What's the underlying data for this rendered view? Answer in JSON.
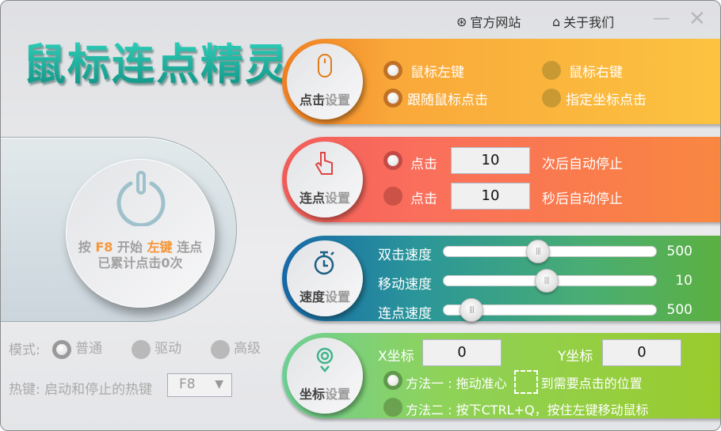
{
  "titlebar": {
    "official_site": "官方网站",
    "about_us": "关于我们",
    "minimize": "—",
    "close": "✕"
  },
  "logo": "鼠标连点精灵",
  "start": {
    "line1_pre": "按",
    "hotkey": "F8",
    "line1_mid": "开始",
    "button": "左键",
    "line1_post": "连点",
    "line2": "已累计点击0次"
  },
  "mode": {
    "label": "模式:",
    "options": [
      "普通",
      "驱动",
      "高级"
    ],
    "selected": 0
  },
  "hotkey": {
    "label": "热键: 启动和停止的热键",
    "value": "F8",
    "arrow": "▼"
  },
  "click_settings": {
    "title_a": "点击",
    "title_b": "设置",
    "options": [
      "鼠标左键",
      "鼠标右键",
      "跟随鼠标点击",
      "指定坐标点击"
    ],
    "colors": [
      "#f08a28",
      "#fcc23c"
    ]
  },
  "repeat_settings": {
    "title_a": "连点",
    "title_b": "设置",
    "row1": {
      "label": "点击",
      "value": "10",
      "suffix": "次后自动停止",
      "selected": true
    },
    "row2": {
      "label": "点击",
      "value": "10",
      "suffix": "秒后自动停止",
      "selected": false
    },
    "colors": [
      "#f5675c",
      "#f98540"
    ]
  },
  "speed_settings": {
    "title_a": "速度",
    "title_b": "设置",
    "sliders": [
      {
        "label": "双击速度",
        "value": "500",
        "fraction": 0.44
      },
      {
        "label": "移动速度",
        "value": "10",
        "fraction": 0.48
      },
      {
        "label": "连点速度",
        "value": "500",
        "fraction": 0.13
      }
    ]
  },
  "coord_settings": {
    "title_a": "坐标",
    "title_b": "设置",
    "x_label": "X坐标",
    "x_value": "0",
    "y_label": "Y坐标",
    "y_value": "0",
    "method1_pre": "方法一 : 拖动准心",
    "method1_post": "到需要点击的位置",
    "method2": "方法二 : 按下CTRL+Q，按住左键移动鼠标"
  }
}
